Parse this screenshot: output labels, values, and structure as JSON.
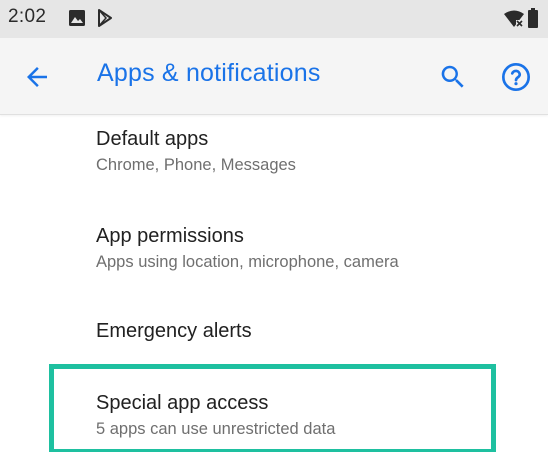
{
  "status_bar": {
    "time": "2:02",
    "icons": [
      "image-icon",
      "play-store-icon",
      "wifi-icon",
      "battery-icon"
    ]
  },
  "app_bar": {
    "title": "Apps & notifications",
    "back_icon": "arrow-back-icon",
    "search_icon": "search-icon",
    "help_icon": "help-icon"
  },
  "items": [
    {
      "title": "Default apps",
      "subtitle": "Chrome, Phone, Messages"
    },
    {
      "title": "App permissions",
      "subtitle": "Apps using location, microphone, camera"
    },
    {
      "title": "Emergency alerts",
      "subtitle": ""
    },
    {
      "title": "Special app access",
      "subtitle": "5 apps can use unrestricted data"
    }
  ],
  "colors": {
    "accent": "#1a73e8",
    "highlight": "#1ec0a0",
    "status_bar": "#e6e6e6",
    "app_bar": "#f5f5f5"
  }
}
